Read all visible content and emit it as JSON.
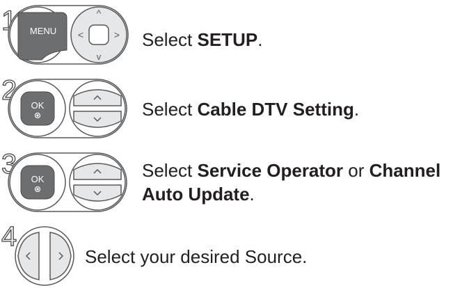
{
  "steps": [
    {
      "number": "1",
      "keys": [
        "menu-icon",
        "navigation-pad-icon"
      ],
      "menu_key_label": "MENU",
      "nav_arrows": [
        "^",
        "<",
        ">",
        "v"
      ],
      "text_prefix": "Select ",
      "text_bold": "SETUP",
      "text_suffix": "."
    },
    {
      "number": "2",
      "keys": [
        "ok-icon",
        "up-down-icon"
      ],
      "ok_key_label": "OK",
      "text_prefix": "Select ",
      "text_bold": "Cable DTV Setting",
      "text_suffix": "."
    },
    {
      "number": "3",
      "keys": [
        "ok-icon",
        "up-down-icon"
      ],
      "ok_key_label": "OK",
      "text_prefix": "Select ",
      "text_bold": "Service Operator",
      "text_mid": " or ",
      "text_bold2_line1": "Channel",
      "text_bold2_line2": "Auto Update",
      "text_suffix": "."
    },
    {
      "number": "4",
      "keys": [
        "left-right-icon"
      ],
      "text": "Select your desired Source."
    }
  ],
  "colors": {
    "key_dark": "#6d6e70",
    "key_light": "#e6e7e8",
    "outline": "#58595b",
    "text": "#231f20"
  }
}
